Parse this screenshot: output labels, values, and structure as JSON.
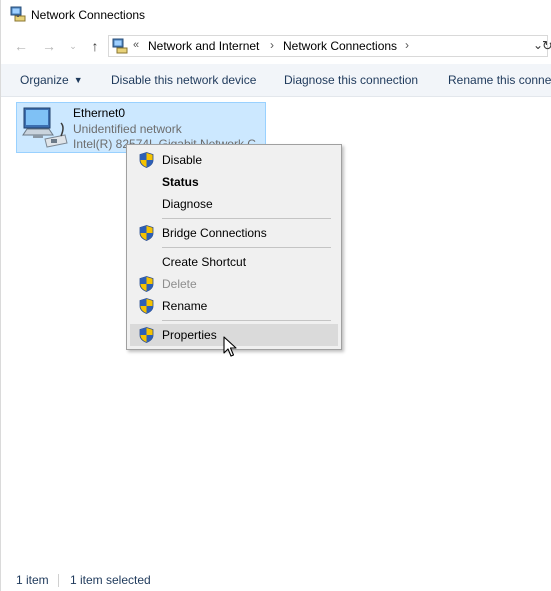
{
  "window": {
    "title": "Network Connections",
    "app_icon": "network-connections-icon"
  },
  "nav": {
    "back_icon": "back-arrow-icon",
    "forward_icon": "forward-arrow-icon",
    "recent_icon": "chevron-down-icon",
    "up_icon": "up-arrow-icon",
    "address": {
      "overflow": "«",
      "breadcrumbs": [
        "Network and Internet",
        "Network Connections"
      ],
      "separator": "›"
    }
  },
  "command_bar": {
    "organize": "Organize",
    "disable": "Disable this network device",
    "diagnose": "Diagnose this connection",
    "rename": "Rename this conne"
  },
  "item": {
    "name": "Ethernet0",
    "status": "Unidentified network",
    "device": "Intel(R) 82574L Gigabit Network C"
  },
  "context_menu": {
    "items": [
      {
        "label": "Disable",
        "shield": true
      },
      {
        "label": "Status",
        "bold": true
      },
      {
        "label": "Diagnose"
      },
      {
        "label": "Bridge Connections",
        "shield": true
      },
      {
        "label": "Create Shortcut"
      },
      {
        "label": "Delete",
        "shield": true,
        "disabled": true
      },
      {
        "label": "Rename",
        "shield": true
      },
      {
        "label": "Properties",
        "shield": true,
        "highlighted": true
      }
    ]
  },
  "status_bar": {
    "count": "1 item",
    "selected": "1 item selected"
  },
  "colors": {
    "selection": "#cce8ff",
    "selection_border": "#99d1ff",
    "command_text": "#1e395b",
    "menu_bg": "#f0f0f0"
  }
}
